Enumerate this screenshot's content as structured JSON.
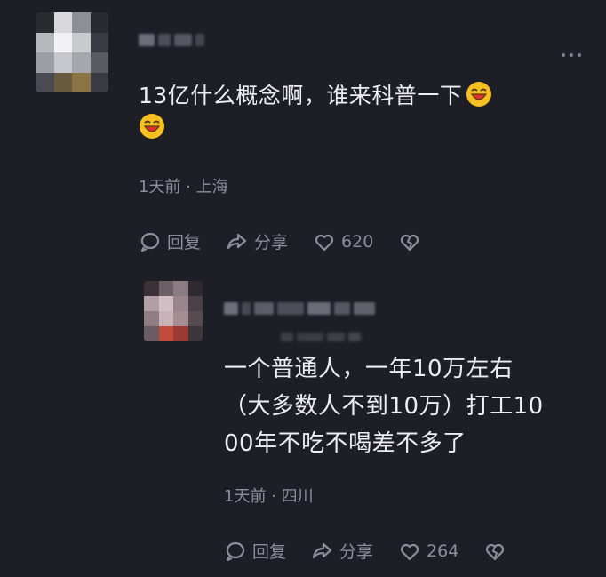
{
  "main_comment": {
    "text_line1": "13亿什么概念啊，谁来科普一下",
    "meta": "1天前 · 上海",
    "actions": {
      "reply_label": "回复",
      "share_label": "分享",
      "like_count": "620"
    },
    "emoji": "laughing-face"
  },
  "reply_comment": {
    "lines": [
      "一个普通人，一年10万左右",
      "（大多数人不到10万）打工10",
      "00年不吃不喝差不多了"
    ],
    "meta": "1天前 · 四川",
    "actions": {
      "reply_label": "回复",
      "share_label": "分享",
      "like_count": "264"
    }
  },
  "colors": {
    "background": "#1e1f26",
    "text": "#ededf2",
    "muted": "#8c8e98",
    "emoji_yellow": "#f5c020",
    "emoji_red": "#e0302b"
  }
}
